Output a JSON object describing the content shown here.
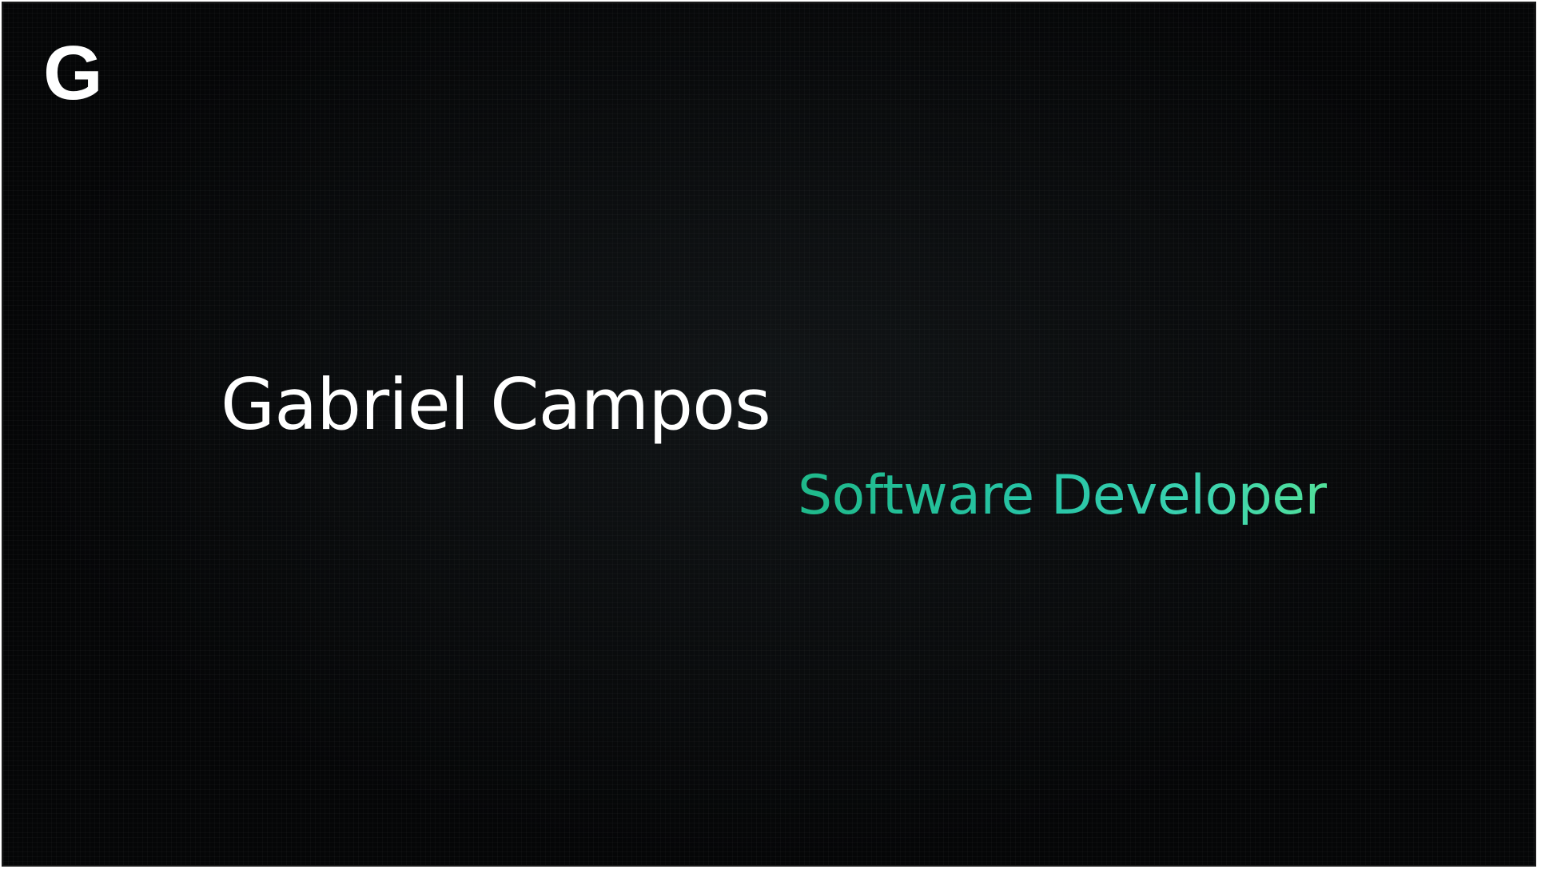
{
  "logo": {
    "letter": "G"
  },
  "hero": {
    "name": "Gabriel Campos",
    "role": "Software Developer"
  },
  "colors": {
    "background": "#050607",
    "text": "#ffffff",
    "accent_start": "#1fb98a",
    "accent_end": "#52e09a"
  }
}
